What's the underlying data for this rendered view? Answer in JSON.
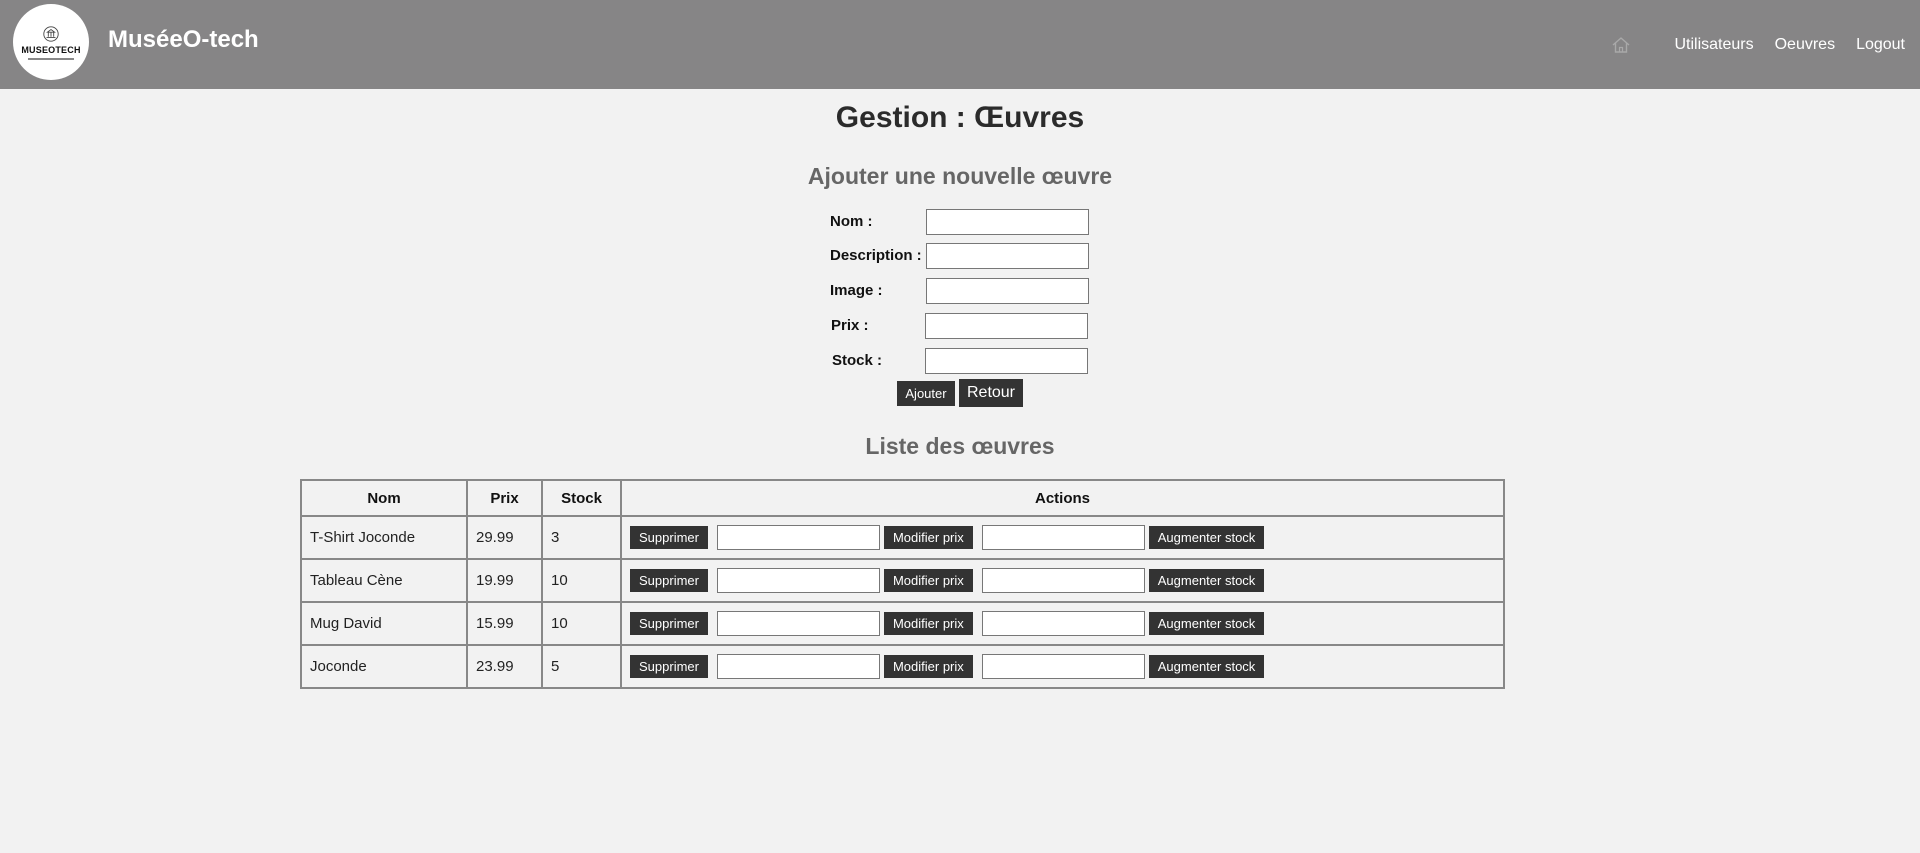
{
  "header": {
    "logo_text": "MUSEOTECH",
    "brand": "MuséeO-tech",
    "nav": [
      {
        "label": "Utilisateurs"
      },
      {
        "label": "Oeuvres"
      },
      {
        "label": "Logout"
      }
    ]
  },
  "page": {
    "title": "Gestion : Œuvres"
  },
  "form": {
    "title": "Ajouter une nouvelle œuvre",
    "fields": [
      {
        "label": "Nom :",
        "value": ""
      },
      {
        "label": "Description :",
        "value": ""
      },
      {
        "label": "Image :",
        "value": ""
      },
      {
        "label": "Prix :",
        "value": ""
      },
      {
        "label": "Stock :",
        "value": ""
      }
    ],
    "submit_label": "Ajouter",
    "back_label": "Retour"
  },
  "list": {
    "title": "Liste des œuvres",
    "columns": [
      "Nom",
      "Prix",
      "Stock",
      "Actions"
    ],
    "action_labels": {
      "delete": "Supprimer",
      "edit_price": "Modifier prix",
      "add_stock": "Augmenter stock"
    },
    "rows": [
      {
        "nom": "T-Shirt Joconde",
        "prix": "29.99",
        "stock": "3"
      },
      {
        "nom": "Tableau Cène",
        "prix": "19.99",
        "stock": "10"
      },
      {
        "nom": "Mug David",
        "prix": "15.99",
        "stock": "10"
      },
      {
        "nom": "Joconde",
        "prix": "23.99",
        "stock": "5"
      }
    ]
  },
  "colors": {
    "header_bg": "#868586",
    "page_bg": "#f2f2f2",
    "button_bg": "#333333",
    "subtitle": "#666666"
  },
  "icons": {
    "home": "home-icon"
  }
}
